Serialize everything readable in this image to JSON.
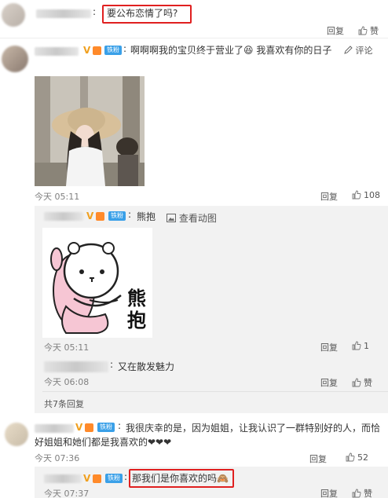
{
  "top": {
    "text": "要公布恋情了吗?",
    "reply_label": "回复",
    "like_label": "赞"
  },
  "comment1": {
    "badge": "V",
    "fan_label": "铁粉",
    "text": "啊啊啊我的宝贝终于营业了😆 我喜欢有你的日子",
    "action_label": "评论",
    "time": "今天 05:11",
    "reply_label": "回复",
    "likes": "108"
  },
  "sub1": {
    "badge": "V",
    "fan_label": "铁粉",
    "text": "熊抱",
    "view_anim": "查看动图",
    "sticker_text": "熊抱",
    "time": "今天 05:11",
    "reply_label": "回复",
    "likes": "1"
  },
  "sub2": {
    "text": "又在散发魅力",
    "time": "今天 06:08",
    "reply_label": "回复",
    "like_label": "赞"
  },
  "more_replies": "共7条回复",
  "comment2": {
    "badge": "V",
    "fan_label": "铁粉",
    "text_line1": "我很庆幸的是，因为姐姐，让我认识了一群特别好的人，而恰",
    "text_line2": "好姐姐和她们都是我喜欢的❤❤❤",
    "time": "今天 07:36",
    "reply_label": "回复",
    "likes": "52"
  },
  "sub3": {
    "badge": "V",
    "fan_label": "铁粉",
    "text": "那我们是你喜欢的吗🙈",
    "time": "今天 07:37",
    "reply_label": "回复",
    "like_label": "赞"
  },
  "colors": {
    "highlight": "#e02020",
    "link": "#3878c8",
    "fan_badge": "#3aa0e8",
    "v_badge": "#f0a020"
  }
}
